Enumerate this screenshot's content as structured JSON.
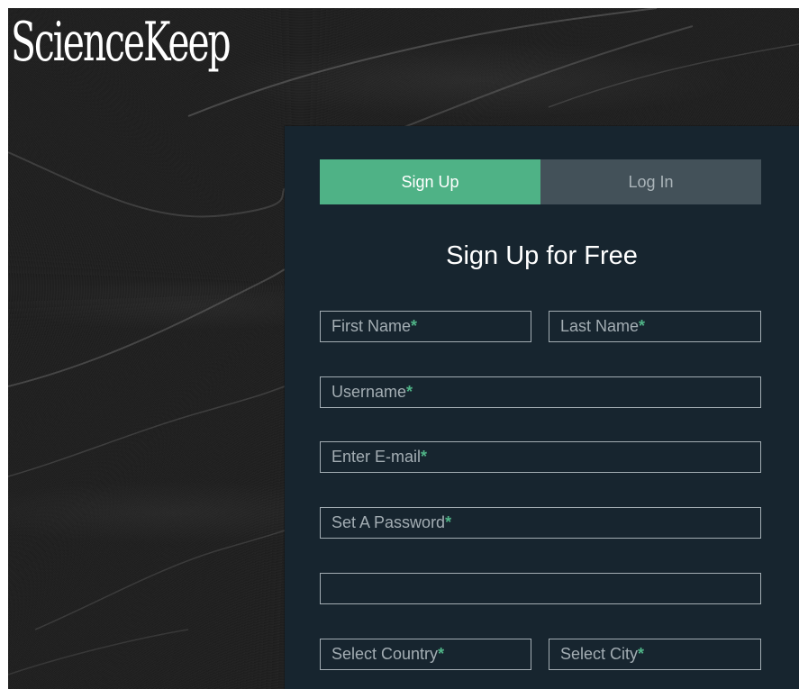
{
  "app": {
    "logo_text": "ScienceKeep"
  },
  "tabs": [
    {
      "label": "Sign Up",
      "active": true
    },
    {
      "label": "Log In",
      "active": false
    }
  ],
  "form": {
    "heading": "Sign Up for Free",
    "required_marker": "*",
    "fields": {
      "first_name": {
        "placeholder": "First Name",
        "value": ""
      },
      "last_name": {
        "placeholder": "Last Name",
        "value": ""
      },
      "username": {
        "placeholder": "Username",
        "value": ""
      },
      "email": {
        "placeholder": "Enter E-mail",
        "value": ""
      },
      "password": {
        "placeholder": "Set A Password",
        "value": ""
      },
      "extra": {
        "placeholder": "",
        "value": ""
      },
      "country": {
        "placeholder": "Select Country",
        "value": ""
      },
      "city": {
        "placeholder": "Select City",
        "value": ""
      }
    }
  },
  "colors": {
    "accent": "#4fb286",
    "panel_bg": "#17252f",
    "inactive_tab": "#435159",
    "field_border": "#a3adb3"
  }
}
